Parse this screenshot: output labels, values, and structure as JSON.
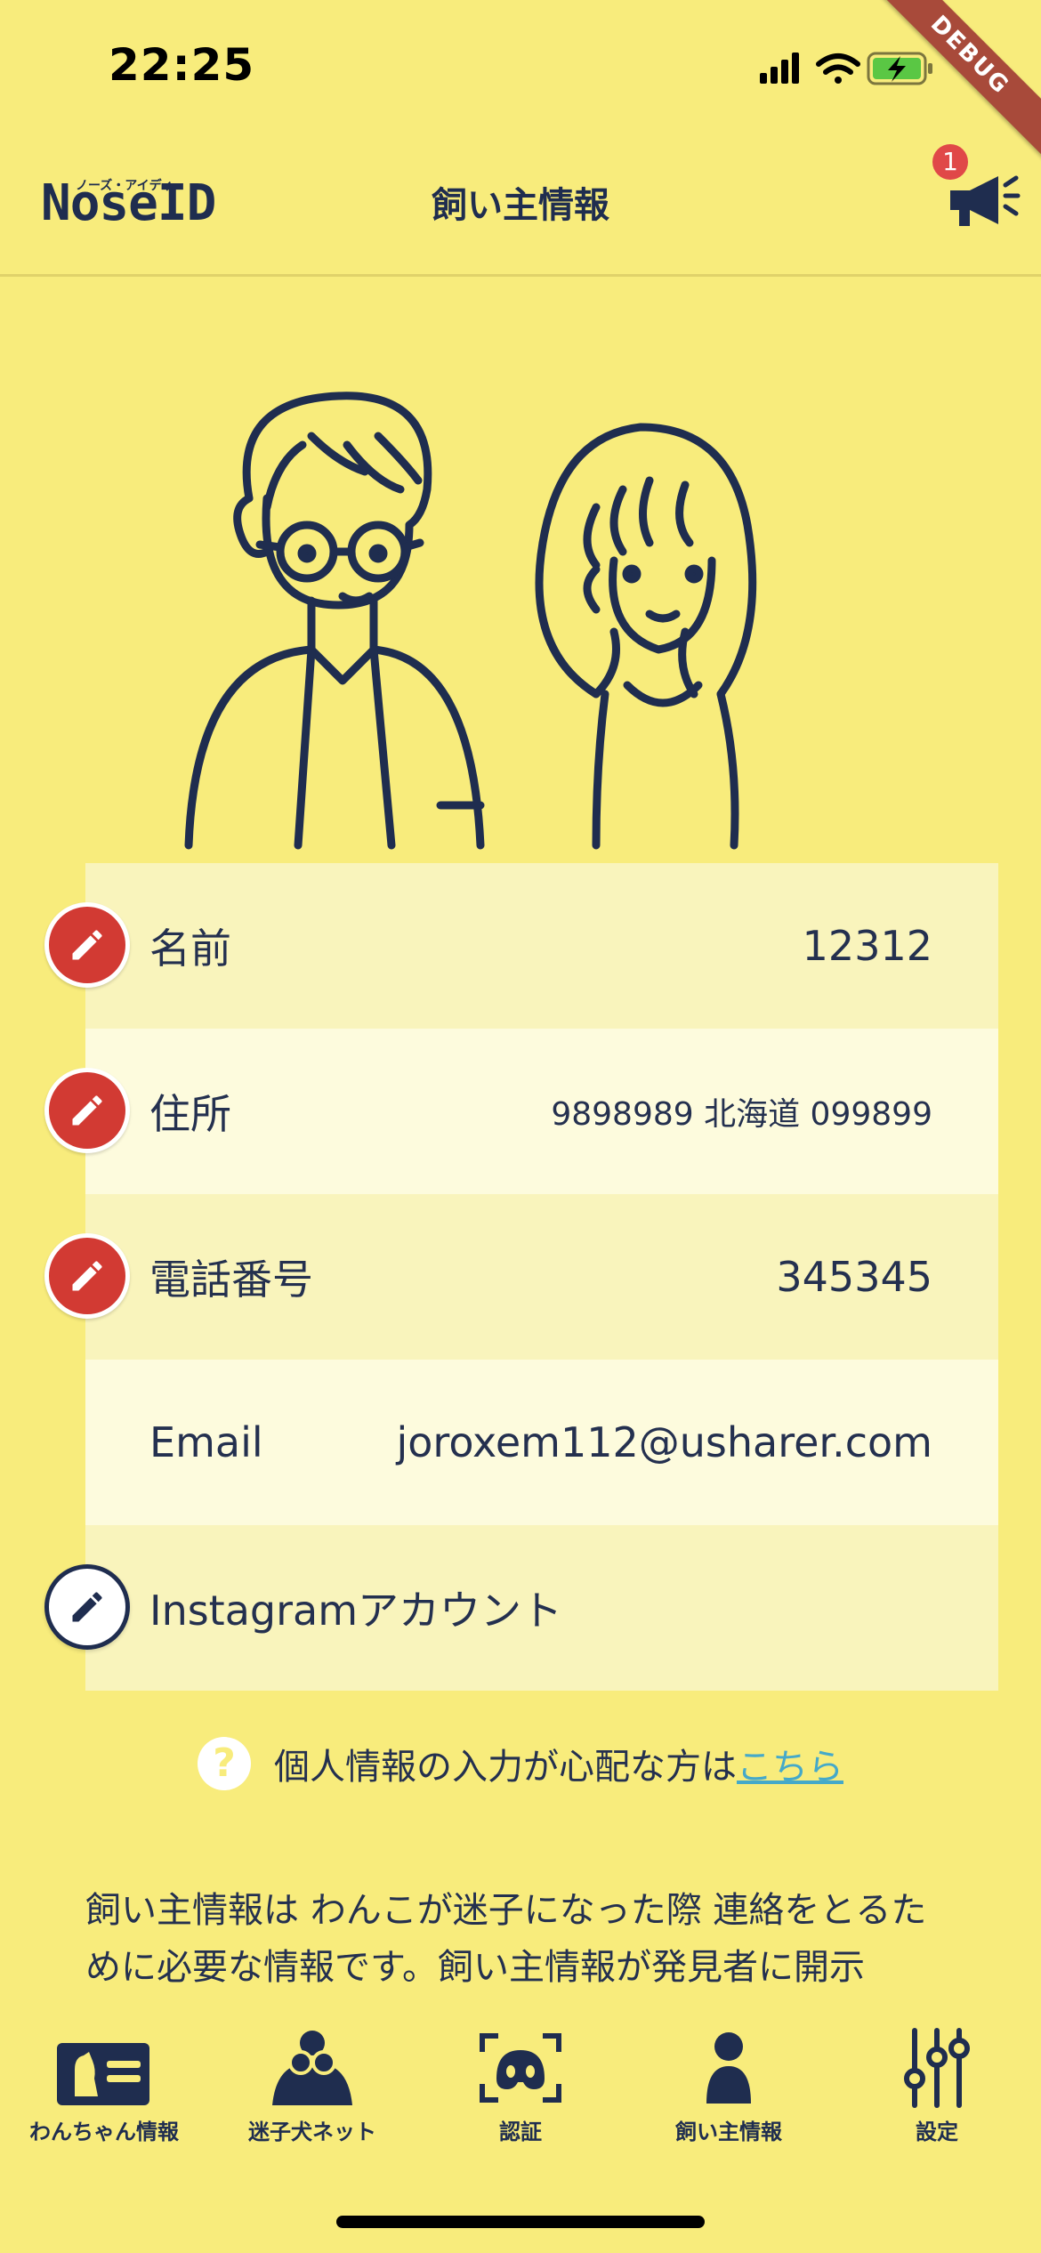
{
  "status_bar": {
    "time": "22:25",
    "debug_label": "DEBUG"
  },
  "header": {
    "logo_ruby": "ノーズ・アイディ",
    "logo": "NoseID",
    "title": "飼い主情報",
    "notification_count": "1"
  },
  "owner_info": {
    "rows": [
      {
        "label": "名前",
        "value": "12312",
        "editable": true
      },
      {
        "label": "住所",
        "value": "9898989 北海道 099899",
        "editable": true
      },
      {
        "label": "電話番号",
        "value": "345345",
        "editable": true
      },
      {
        "label": "Email",
        "value": "joroxem112@usharer.com",
        "editable": false
      },
      {
        "label": "Instagramアカウント",
        "value": "",
        "editable": true
      }
    ]
  },
  "help": {
    "text": "個人情報の入力が心配な方は",
    "link": "こちら"
  },
  "description": "飼い主情報は わんこが迷子になった際 連絡をとるために必要な情報です。飼い主情報が発見者に開示",
  "bottom_nav": {
    "items": [
      {
        "label": "わんちゃん情報",
        "icon": "dog-card-icon"
      },
      {
        "label": "迷子犬ネット",
        "icon": "binoculars-icon"
      },
      {
        "label": "認証",
        "icon": "nose-scan-icon"
      },
      {
        "label": "飼い主情報",
        "icon": "person-icon"
      },
      {
        "label": "設定",
        "icon": "sliders-icon"
      }
    ]
  },
  "colors": {
    "background": "#F8EC7C",
    "text": "#1F2D4F",
    "edit_red": "#D23A33",
    "link": "#45A9C9",
    "badge": "#E04848"
  }
}
